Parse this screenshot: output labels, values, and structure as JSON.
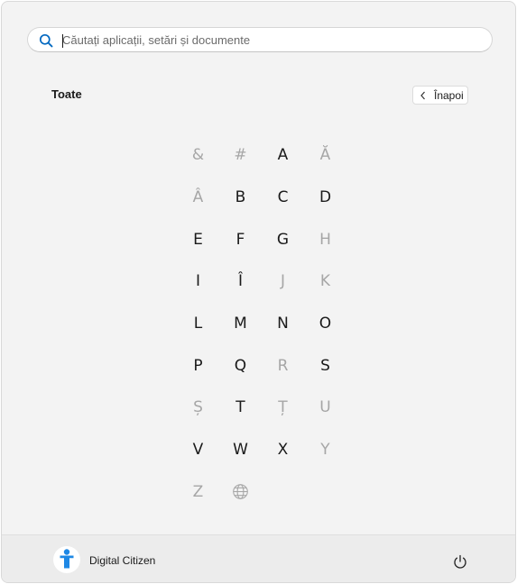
{
  "search": {
    "placeholder": "Căutați aplicații, setări și documente",
    "icon": "search-icon",
    "icon_color": "#0067c0"
  },
  "section": {
    "title": "Toate"
  },
  "back_button": {
    "label": "Înapoi",
    "icon": "chevron-left-icon"
  },
  "letter_grid": {
    "letters": [
      {
        "label": "&",
        "enabled": false
      },
      {
        "label": "#",
        "enabled": false
      },
      {
        "label": "A",
        "enabled": true
      },
      {
        "label": "Ă",
        "enabled": false
      },
      {
        "label": "Â",
        "enabled": false
      },
      {
        "label": "B",
        "enabled": true
      },
      {
        "label": "C",
        "enabled": true
      },
      {
        "label": "D",
        "enabled": true
      },
      {
        "label": "E",
        "enabled": true
      },
      {
        "label": "F",
        "enabled": true
      },
      {
        "label": "G",
        "enabled": true
      },
      {
        "label": "H",
        "enabled": false
      },
      {
        "label": "I",
        "enabled": true
      },
      {
        "label": "Î",
        "enabled": true
      },
      {
        "label": "J",
        "enabled": false
      },
      {
        "label": "K",
        "enabled": false
      },
      {
        "label": "L",
        "enabled": true
      },
      {
        "label": "M",
        "enabled": true
      },
      {
        "label": "N",
        "enabled": true
      },
      {
        "label": "O",
        "enabled": true
      },
      {
        "label": "P",
        "enabled": true
      },
      {
        "label": "Q",
        "enabled": true
      },
      {
        "label": "R",
        "enabled": false
      },
      {
        "label": "S",
        "enabled": true
      },
      {
        "label": "Ș",
        "enabled": false
      },
      {
        "label": "T",
        "enabled": true
      },
      {
        "label": "Ț",
        "enabled": false
      },
      {
        "label": "U",
        "enabled": false
      },
      {
        "label": "V",
        "enabled": true
      },
      {
        "label": "W",
        "enabled": true
      },
      {
        "label": "X",
        "enabled": true
      },
      {
        "label": "Y",
        "enabled": false
      },
      {
        "label": "Z",
        "enabled": false
      },
      {
        "label": "",
        "icon": "globe-icon",
        "enabled": false
      }
    ],
    "enabled_color": "#1a1a1a",
    "disabled_color": "#a6a6a6"
  },
  "footer": {
    "user_name": "Digital Citizen",
    "avatar_icon": "digital-citizen-logo-icon",
    "avatar_color": "#1e88e5",
    "power_icon": "power-icon"
  }
}
